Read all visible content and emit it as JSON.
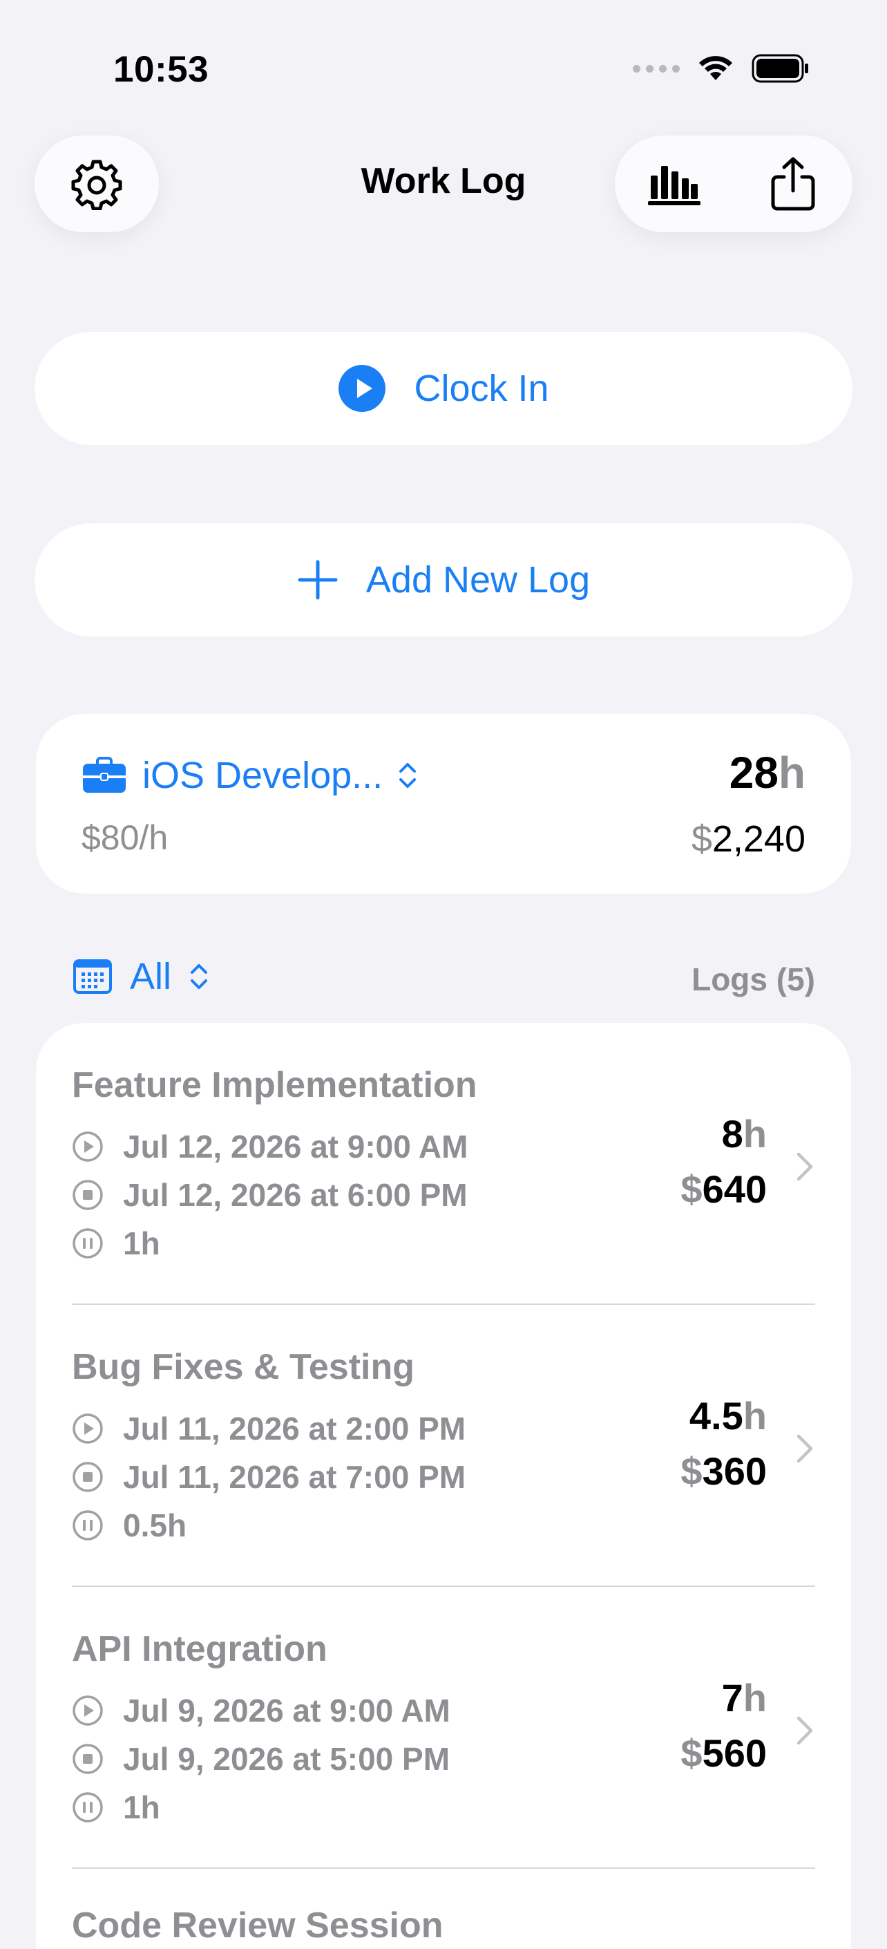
{
  "status_bar": {
    "time": "10:53"
  },
  "nav": {
    "title": "Work Log"
  },
  "actions": {
    "clock_in_label": "Clock In",
    "add_log_label": "Add New Log"
  },
  "project": {
    "name": "iOS Develop...",
    "rate": "$80/h",
    "total_hours": "28",
    "hours_unit": "h",
    "currency": "$",
    "total_amount": "2,240"
  },
  "filter": {
    "selected": "All",
    "logs_count": "Logs (5)"
  },
  "logs": [
    {
      "title": "Feature Implementation",
      "start": "Jul 12, 2026 at 9:00 AM",
      "end": "Jul 12, 2026 at 6:00 PM",
      "break": "1h",
      "hours": "8",
      "amount": "640"
    },
    {
      "title": "Bug Fixes & Testing",
      "start": "Jul 11, 2026 at 2:00 PM",
      "end": "Jul 11, 2026 at 7:00 PM",
      "break": "0.5h",
      "hours": "4.5",
      "amount": "360"
    },
    {
      "title": "API Integration",
      "start": "Jul 9, 2026 at 9:00 AM",
      "end": "Jul 9, 2026 at 5:00 PM",
      "break": "1h",
      "hours": "7",
      "amount": "560"
    },
    {
      "title": "Code Review Session"
    }
  ],
  "colors": {
    "accent": "#1a7ff5",
    "background": "#f2f2f7",
    "secondary_text": "#8e8e93"
  },
  "icons": {
    "settings": "gear-icon",
    "stats": "chart-bar-icon",
    "share": "share-icon",
    "clock_in": "play-circle-icon",
    "add": "plus-icon",
    "project": "briefcase-icon",
    "filter": "calendar-icon"
  }
}
